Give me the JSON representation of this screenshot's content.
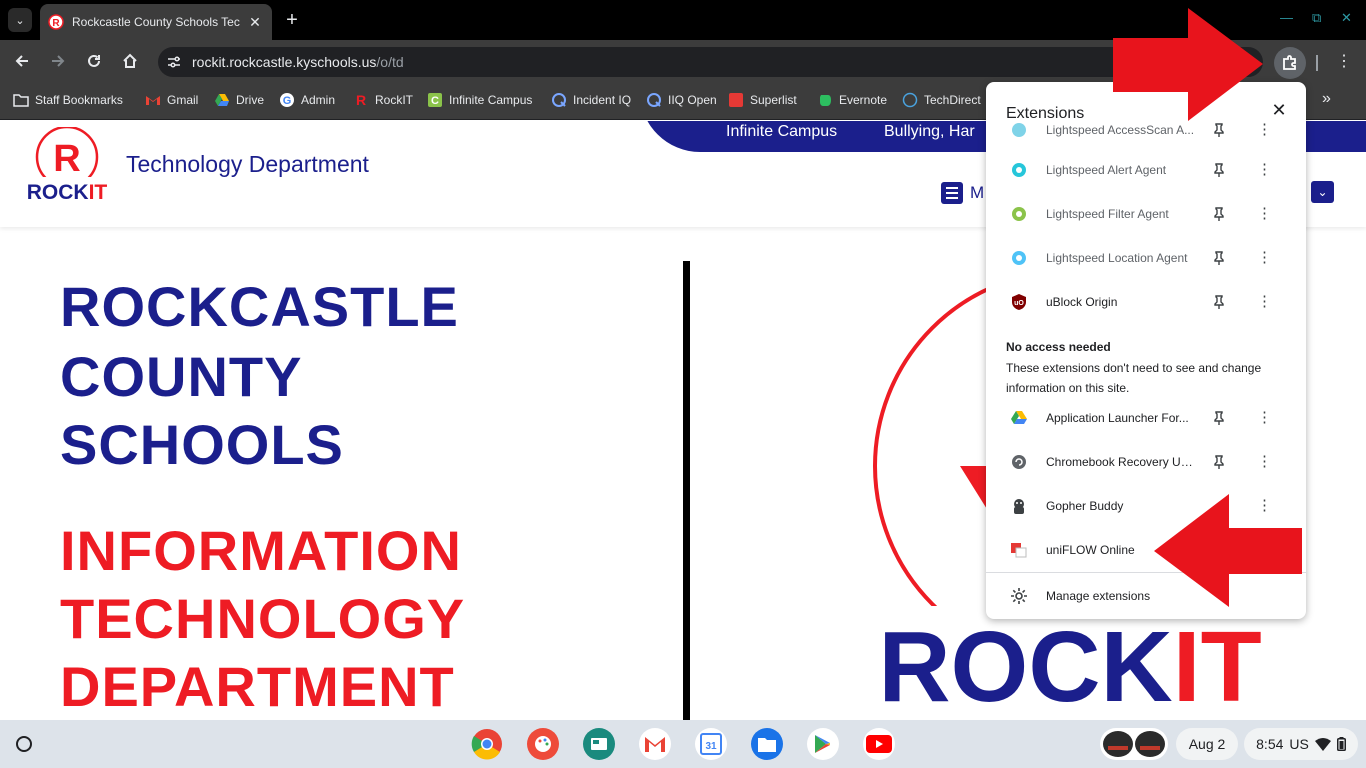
{
  "browser": {
    "tab_title": "Rockcastle County Schools Tec",
    "url_host": "rockit.rockcastle.kyschools.us",
    "url_path": "/o/td"
  },
  "bookmarks": [
    {
      "label": "Staff Bookmarks",
      "icon": "folder-icon"
    },
    {
      "label": "Gmail",
      "icon": "gmail-icon"
    },
    {
      "label": "Drive",
      "icon": "drive-icon"
    },
    {
      "label": "Admin",
      "icon": "google-icon"
    },
    {
      "label": "RockIT",
      "icon": "rockit-icon"
    },
    {
      "label": "Infinite Campus",
      "icon": "campus-icon"
    },
    {
      "label": "Incident IQ",
      "icon": "iiq-icon"
    },
    {
      "label": "IIQ Open",
      "icon": "iiq-icon"
    },
    {
      "label": "Superlist",
      "icon": "superlist-icon"
    },
    {
      "label": "Evernote",
      "icon": "evernote-icon"
    },
    {
      "label": "TechDirect",
      "icon": "dell-icon"
    }
  ],
  "site": {
    "title": "Technology Department",
    "nav_links": [
      "Infinite Campus",
      "Bullying, Har"
    ],
    "menu_label": "M",
    "logo_text_a": "ROCK",
    "logo_text_b": "IT",
    "hero_blue": [
      "ROCKCASTLE",
      "COUNTY",
      "SCHOOLS"
    ],
    "hero_red": [
      "INFORMATION",
      "TECHNOLOGY",
      "DEPARTMENT"
    ],
    "big_logo_a": "ROCK",
    "big_logo_b": "IT"
  },
  "extensions": {
    "title": "Extensions",
    "access_items": [
      {
        "name": "Lightspeed AccessScan A...",
        "icon": "lightspeed-accessscan-icon"
      },
      {
        "name": "Lightspeed Alert Agent",
        "icon": "lightspeed-alert-icon"
      },
      {
        "name": "Lightspeed Filter Agent",
        "icon": "lightspeed-filter-icon"
      },
      {
        "name": "Lightspeed Location Agent",
        "icon": "lightspeed-location-icon"
      },
      {
        "name": "uBlock Origin",
        "icon": "ublock-icon"
      }
    ],
    "section_heading": "No access needed",
    "section_desc": "These extensions don't need to see and change information on this site.",
    "no_access_items": [
      {
        "name": "Application Launcher For...",
        "icon": "drive-icon"
      },
      {
        "name": "Chromebook Recovery Util...",
        "icon": "recovery-icon"
      },
      {
        "name": "Gopher Buddy",
        "icon": "gopher-icon"
      },
      {
        "name": "uniFLOW Online",
        "icon": "uniflow-icon"
      }
    ],
    "manage_label": "Manage extensions"
  },
  "shelf": {
    "date": "Aug 2",
    "time": "8:54",
    "locale": "US"
  },
  "colors": {
    "brand_blue": "#1b1f8c",
    "brand_red": "#ee1c24",
    "arrow_red": "#e8141c"
  }
}
